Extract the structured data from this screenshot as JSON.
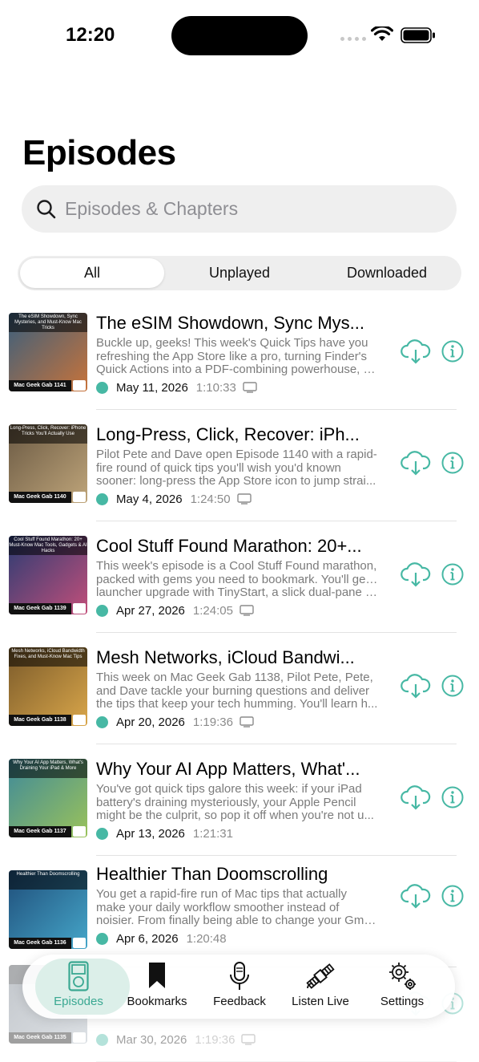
{
  "status_bar": {
    "time": "12:20"
  },
  "page": {
    "title": "Episodes"
  },
  "search": {
    "placeholder": "Episodes & Chapters",
    "value": ""
  },
  "filter_tabs": [
    {
      "label": "All",
      "selected": true
    },
    {
      "label": "Unplayed",
      "selected": false
    },
    {
      "label": "Downloaded",
      "selected": false
    }
  ],
  "colors": {
    "accent": "#47b8a4",
    "secondary_text": "#7b7b7b"
  },
  "episodes": [
    {
      "title": "The eSIM Showdown, Sync Mys...",
      "desc": [
        "Buckle up, geeks! This week's Quick Tips have you",
        "refreshing the App Store like a pro, turning Finder's",
        "Quick Actions into a PDF-combining powerhouse, s..."
      ],
      "date": "May 11, 2026",
      "duration": "1:10:33",
      "thumb_caption": "The eSIM Showdown, Sync Mysteries, and Must-Know Mac Tricks",
      "thumb_footer": "Mac Geek Gab 1141",
      "thumb_colors": [
        "#3a5f7d",
        "#c8733a"
      ]
    },
    {
      "title": "Long-Press, Click, Recover: iPh...",
      "desc": [
        "Pilot Pete and Dave open Episode 1140 with a rapid-",
        "fire round of quick tips you'll wish you'd known",
        "sooner: long-press the App Store icon to jump strai..."
      ],
      "date": "May 4, 2026",
      "duration": "1:24:50",
      "thumb_caption": "Long-Press, Click, Recover: iPhone Tricks You'll Actually Use",
      "thumb_footer": "Mac Geek Gab 1140",
      "thumb_colors": [
        "#6b5a44",
        "#bfa57a"
      ]
    },
    {
      "title": "Cool Stuff Found Marathon: 20+...",
      "desc": [
        "This week's episode is a Cool Stuff Found marathon,",
        "packed with gems you need to bookmark. You'll get a",
        "launcher upgrade with TinyStart, a slick dual-pane f..."
      ],
      "date": "Apr 27, 2026",
      "duration": "1:24:05",
      "thumb_caption": "Cool Stuff Found Marathon: 20+ Must-Know Mac Tools, Gadgets & AI Hacks",
      "thumb_footer": "Mac Geek Gab 1139",
      "thumb_colors": [
        "#2b3c73",
        "#c24f7a"
      ]
    },
    {
      "title": "Mesh Networks, iCloud Bandwi...",
      "desc": [
        "This week on Mac Geek Gab 1138, Pilot Pete, Pete,",
        "and Dave tackle your burning questions and deliver",
        "the tips that keep your tech humming. You'll learn h..."
      ],
      "date": "Apr 20, 2026",
      "duration": "1:19:36",
      "thumb_caption": "Mesh Networks, iCloud Bandwidth Fixes, and Must-Know Mac Tips",
      "thumb_footer": "Mac Geek Gab 1138",
      "thumb_colors": [
        "#7a5a2a",
        "#d9a64a"
      ]
    },
    {
      "title": "Why Your AI App Matters, What'...",
      "desc": [
        "You've got quick tips galore this week: if your iPad",
        "battery's draining mysteriously, your Apple Pencil",
        "might be the culprit, so pop it off when you're not u..."
      ],
      "date": "Apr 13, 2026",
      "duration": "1:21:31",
      "thumb_caption": "Why Your AI App Matters, What's Draining Your iPad & More",
      "thumb_footer": "Mac Geek Gab 1137",
      "thumb_colors": [
        "#3f8a9a",
        "#9ac25a"
      ]
    },
    {
      "title": "Healthier Than Doomscrolling",
      "desc": [
        "You get a rapid-fire run of Mac tips that actually",
        "make your daily workflow smoother instead of",
        "noisier. From finally being able to change your Gmai..."
      ],
      "date": "Apr 6, 2026",
      "duration": "1:20:48",
      "thumb_caption": "Healthier Than Doomscrolling",
      "thumb_footer": "Mac Geek Gab 1136",
      "thumb_colors": [
        "#1f4e7a",
        "#45a6c9"
      ]
    },
    {
      "title": "",
      "desc": [
        "",
        "",
        ""
      ],
      "date": "Mar 30, 2026",
      "duration": "1:19:36",
      "thumb_caption": "",
      "thumb_footer": "Mac Geek Gab 1135",
      "thumb_colors": [
        "#6a7480",
        "#a9b3bd"
      ]
    }
  ],
  "tab_bar": [
    {
      "label": "Episodes",
      "icon": "ipod-icon",
      "active": true
    },
    {
      "label": "Bookmarks",
      "icon": "bookmark-icon",
      "active": false
    },
    {
      "label": "Feedback",
      "icon": "microphone-icon",
      "active": false
    },
    {
      "label": "Listen Live",
      "icon": "satellite-icon",
      "active": false
    },
    {
      "label": "Settings",
      "icon": "gear-icon",
      "active": false
    }
  ]
}
